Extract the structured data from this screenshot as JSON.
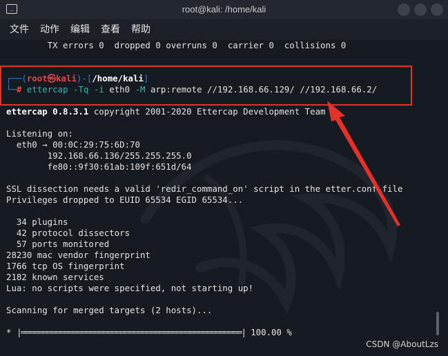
{
  "window": {
    "title": "root@kali: /home/kali"
  },
  "menu": [
    "文件",
    "动作",
    "编辑",
    "查看",
    "帮助"
  ],
  "terminal": {
    "line_tx": "        TX errors 0  dropped 0 overruns 0  carrier 0  collisions 0",
    "prompt": {
      "corner_top": "┌──(",
      "user": "root㉿kali",
      "mid": ")-[",
      "path": "/home/kali",
      "end": "]",
      "corner_bottom": "└─",
      "hash": "#",
      "cmd": "ettercap",
      "flags": "-Tq -i",
      "iface": "eth0",
      "flag_m": "-M",
      "args": "arp:remote //192.168.66.129/ //192.168.66.2/"
    },
    "version_name": "ettercap 0.8.3.1",
    "version_rest": " copyright 2001-2020 Ettercap Development Team",
    "listening": "Listening on:",
    "eth0": "  eth0 → 00:0C:29:75:6D:70",
    "ipv4": "        192.168.66.136/255.255.255.0",
    "ipv6": "        fe80::9f30:61ab:109f:651d/64",
    "ssl": "SSL dissection needs a valid 'redir_command_on' script in the etter.conf file",
    "priv": "Privileges dropped to EUID 65534 EGID 65534...",
    "plugins": "  34 plugins",
    "dissectors": "  42 protocol dissectors",
    "ports": "  57 ports monitored",
    "mac": "28230 mac vendor fingerprint",
    "tcp": "1766 tcp OS fingerprint",
    "services": "2182 known services",
    "lua": "Lua: no scripts were specified, not starting up!",
    "scanning": "Scanning for merged targets (2 hosts)...",
    "progress_star": "*",
    "progress_bar": "|═══════════════════════════════════════════════════|",
    "progress_pct": "100.00 %"
  },
  "watermark": "CSDN @AboutLzs",
  "colors": {
    "annotation": "#e5312a",
    "prompt_blue": "#2f7de0",
    "prompt_red": "#e64545"
  }
}
